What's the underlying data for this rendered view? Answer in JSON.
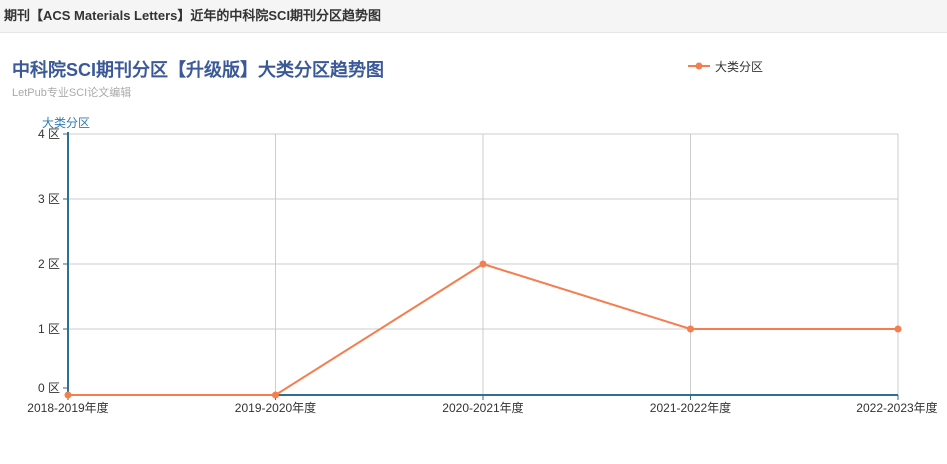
{
  "header": {
    "title": "期刊【ACS Materials Letters】近年的中科院SCI期刊分区趋势图"
  },
  "chart": {
    "title": "中科院SCI期刊分区【升级版】大类分区趋势图",
    "subtitle": "LetPub专业SCI论文编辑",
    "legend_label": "大类分区",
    "line_color": "#f47e4f"
  },
  "chart_data": {
    "type": "line",
    "title": "中科院SCI期刊分区【升级版】大类分区趋势图",
    "subtitle": "LetPub专业SCI论文编辑",
    "xlabel": "",
    "ylabel": "大类分区",
    "categories": [
      "2018-2019年度",
      "2019-2020年度",
      "2020-2021年度",
      "2021-2022年度",
      "2022-2023年度"
    ],
    "y_ticks": [
      "0 区",
      "1 区",
      "2 区",
      "3 区",
      "4 区"
    ],
    "ylim": [
      0,
      4
    ],
    "series": [
      {
        "name": "大类分区",
        "values": [
          0,
          0,
          2,
          1,
          1
        ]
      }
    ],
    "grid": true,
    "legend_position": "top-right"
  }
}
